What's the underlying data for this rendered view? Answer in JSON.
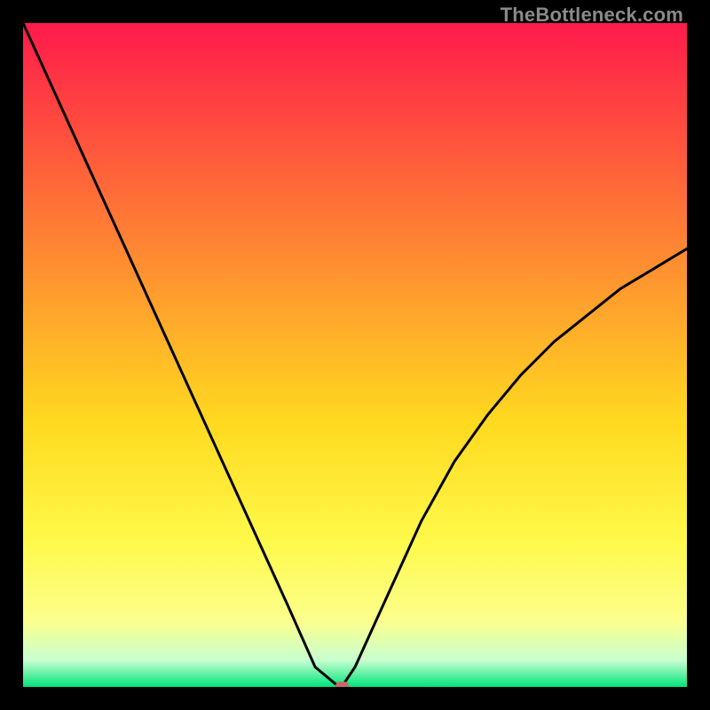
{
  "watermark": "TheBottleneck.com",
  "colors": {
    "frame": "#000000",
    "gradient_stops": [
      "#ff1a4b",
      "#ff5a3c",
      "#ff9a2e",
      "#ffd91f",
      "#fff94a",
      "#fbff8c",
      "#c8ffd0",
      "#00e47a"
    ],
    "curve": "#000000",
    "dot": "#c96a6a"
  },
  "chart_data": {
    "type": "line",
    "title": "",
    "xlabel": "",
    "ylabel": "",
    "categories": [
      0,
      5,
      10,
      15,
      20,
      25,
      30,
      35,
      40,
      44,
      47,
      48,
      50,
      55,
      60,
      65,
      70,
      75,
      80,
      85,
      90,
      95,
      100
    ],
    "values": [
      100,
      89,
      78,
      67,
      56,
      45,
      34,
      23,
      12,
      3,
      0.5,
      0,
      3,
      14,
      25,
      34,
      41,
      47,
      52,
      56,
      60,
      63,
      66
    ],
    "xlim": [
      0,
      100
    ],
    "ylim": [
      0,
      100
    ],
    "bottleneck_x": 48,
    "annotations": []
  }
}
